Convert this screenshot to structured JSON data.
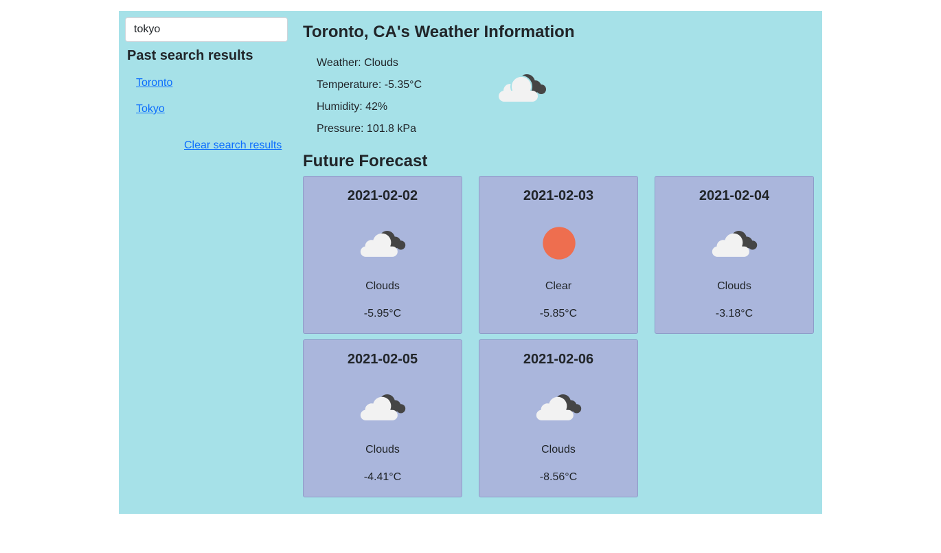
{
  "search": {
    "value": "tokyo"
  },
  "sidebar": {
    "title": "Past search results",
    "history": [
      "Toronto",
      "Tokyo"
    ],
    "clear_label": "Clear search results"
  },
  "current": {
    "title": "Toronto, CA's Weather Information",
    "weather": "Weather: Clouds",
    "temperature": "Temperature: -5.35°C",
    "humidity": "Humidity: 42%",
    "pressure": "Pressure: 101.8 kPa",
    "icon": "clouds-icon"
  },
  "forecast": {
    "title": "Future Forecast",
    "days": [
      {
        "date": "2021-02-02",
        "desc": "Clouds",
        "temp": "-5.95°C",
        "icon": "clouds-icon"
      },
      {
        "date": "2021-02-03",
        "desc": "Clear",
        "temp": "-5.85°C",
        "icon": "sun-icon"
      },
      {
        "date": "2021-02-04",
        "desc": "Clouds",
        "temp": "-3.18°C",
        "icon": "clouds-icon"
      },
      {
        "date": "2021-02-05",
        "desc": "Clouds",
        "temp": "-4.41°C",
        "icon": "clouds-icon"
      },
      {
        "date": "2021-02-06",
        "desc": "Clouds",
        "temp": "-8.56°C",
        "icon": "clouds-icon"
      }
    ]
  },
  "colors": {
    "app_background": "#a6e1e8",
    "card_background": "#aab6dc",
    "link": "#0d6efd",
    "sun": "#ee6e4f"
  }
}
